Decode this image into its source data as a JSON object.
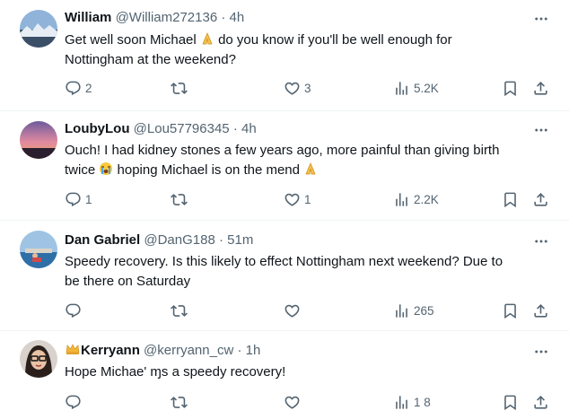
{
  "tweets": [
    {
      "name": "William",
      "handle": "@William272136",
      "separator": "·",
      "time": "4h",
      "lines": [
        "Get well soon Michael",
        "do you know if you'll be well enough for",
        "Nottingham at the weekend?"
      ],
      "replies": "2",
      "reposts": "",
      "likes": "3",
      "views": "5.2K"
    },
    {
      "name": "LoubyLou",
      "handle": "@Lou57796345",
      "separator": "·",
      "time": "4h",
      "lines": [
        "Ouch! I had kidney stones a few years ago, more painful than giving birth",
        "twice",
        "hoping Michael is on the mend"
      ],
      "replies": "1",
      "reposts": "",
      "likes": "1",
      "views": "2.2K"
    },
    {
      "name": "Dan Gabriel",
      "handle": "@DanG188",
      "separator": "·",
      "time": "51m",
      "lines": [
        "Speedy recovery. Is this likely to effect Nottingham next weekend? Due to",
        "be there on Saturday"
      ],
      "replies": "",
      "reposts": "",
      "likes": "",
      "views": "265"
    },
    {
      "name": "Kerryann",
      "handle": "@kerryann_cw",
      "separator": "·",
      "time": "1h",
      "lines": [
        "Hope Michae' ɱs a speedy recovery!"
      ],
      "replies": "",
      "reposts": "",
      "likes": "",
      "views": "1 8"
    }
  ],
  "icons": {
    "reply": "reply-icon",
    "repost": "repost-icon",
    "like": "heart-icon",
    "views": "analytics-icon",
    "bookmark": "bookmark-icon",
    "share": "share-icon",
    "more": "more-options-icon",
    "emoji_pray": "folded-hands-emoji",
    "emoji_cry": "loudly-crying-emoji",
    "emoji_crown": "crown-emoji"
  },
  "colors": {
    "text": "#0f1419",
    "secondary": "#536471",
    "divider": "#eff3f4"
  }
}
